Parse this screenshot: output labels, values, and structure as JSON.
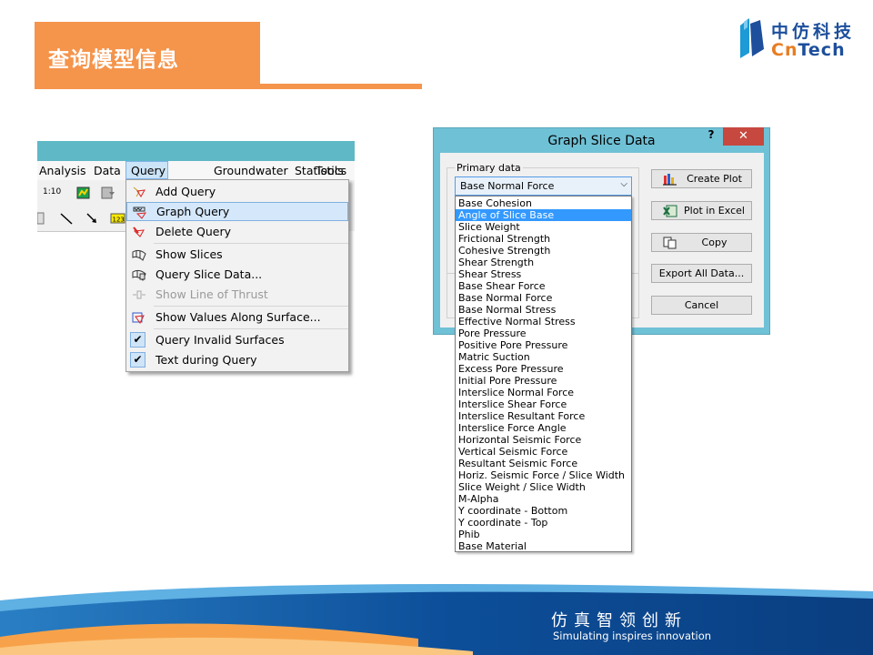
{
  "slide": {
    "title": "查询模型信息",
    "logo_cn": "中仿科技",
    "logo_en_prefix": "Cn",
    "logo_en_suffix": "Tech",
    "slogan_cn": "仿真智领创新",
    "slogan_en": "Simulating inspires innovation"
  },
  "colors": {
    "accent": "#f5944b",
    "brand_blue": "#1d4f9c",
    "brand_orange": "#e87d23",
    "highlight": "#3399ff"
  },
  "menubar": {
    "items": [
      "Analysis",
      "Data",
      "Query",
      "Groundwater",
      "Statistics",
      "Tools"
    ],
    "toolbar_zoom": "1:10"
  },
  "query_menu": {
    "items": [
      {
        "label": "Add Query",
        "icon": "add-query-icon"
      },
      {
        "label": "Graph Query",
        "icon": "graph-query-icon",
        "highlighted": true
      },
      {
        "label": "Delete Query",
        "icon": "delete-query-icon"
      },
      {
        "label": "Show Slices",
        "icon": "show-slices-icon"
      },
      {
        "label": "Query Slice Data...",
        "icon": "query-slice-data-icon"
      },
      {
        "label": "Show Line of Thrust",
        "icon": "line-of-thrust-icon",
        "disabled": true
      },
      {
        "label": "Show Values Along Surface...",
        "icon": "values-along-surface-icon"
      },
      {
        "label": "Query Invalid Surfaces",
        "checked": true
      },
      {
        "label": "Text during Query",
        "checked": true
      }
    ]
  },
  "dialog": {
    "title": "Graph Slice Data",
    "help": "?",
    "close": "✕",
    "group_label": "Primary data",
    "selected_value": "Base Normal Force",
    "buttons": {
      "create_plot": "Create Plot",
      "plot_excel": "Plot in Excel",
      "copy": "Copy",
      "export_all": "Export All Data...",
      "cancel": "Cancel"
    },
    "options": [
      "Base Cohesion",
      "Angle of Slice Base",
      "Slice Weight",
      "Frictional Strength",
      "Cohesive Strength",
      "Shear Strength",
      "Shear Stress",
      "Base Shear Force",
      "Base Normal Force",
      "Base Normal Stress",
      "Effective Normal Stress",
      "Pore Pressure",
      "Positive Pore Pressure",
      "Matric Suction",
      "Excess Pore Pressure",
      "Initial Pore Pressure",
      "Interslice Normal Force",
      "Interslice Shear Force",
      "Interslice Resultant Force",
      "Interslice Force Angle",
      "Horizontal Seismic Force",
      "Vertical Seismic Force",
      "Resultant Seismic Force",
      "Horiz. Seismic Force / Slice Width",
      "Slice Weight / Slice Width",
      "M-Alpha",
      "Y coordinate - Bottom",
      "Y coordinate - Top",
      "Phib",
      "Base Material"
    ],
    "highlighted_option": "Angle of Slice Base"
  }
}
